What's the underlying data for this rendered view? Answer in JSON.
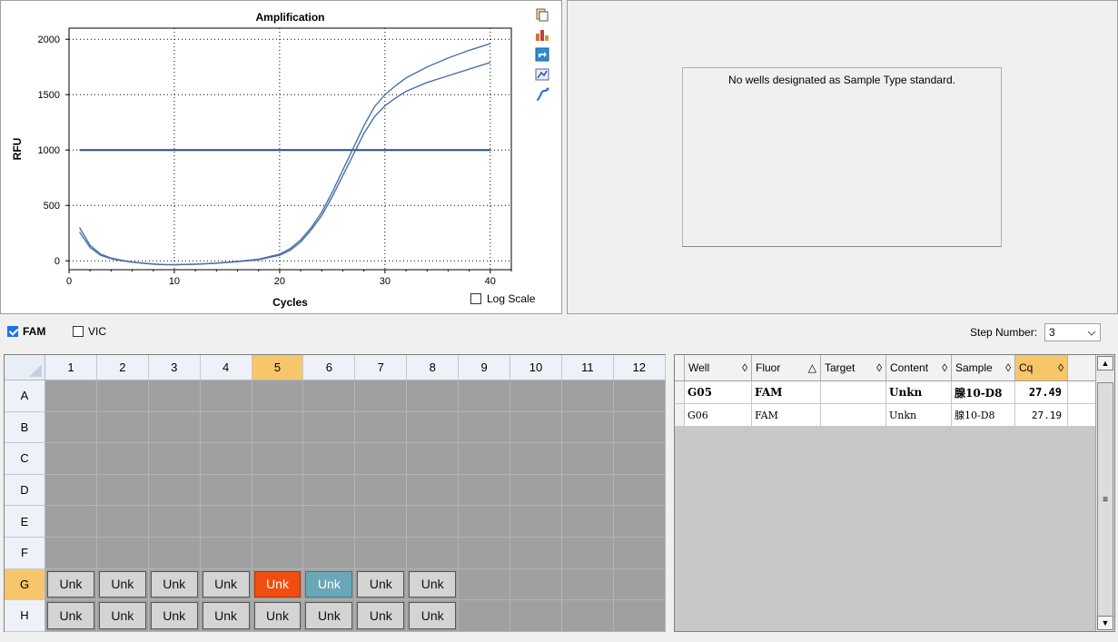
{
  "chart_data": {
    "type": "line",
    "title": "Amplification",
    "xlabel": "Cycles",
    "ylabel": "RFU",
    "xlim": [
      0,
      42
    ],
    "ylim": [
      -80,
      2100
    ],
    "x_ticks": [
      0,
      10,
      20,
      30,
      40
    ],
    "y_ticks": [
      0,
      500,
      1000,
      1500,
      2000
    ],
    "grid": true,
    "series": [
      {
        "color": "#4a72a8",
        "x": [
          1,
          2,
          3,
          4,
          5,
          6,
          7,
          8,
          9,
          10,
          12,
          14,
          16,
          18,
          20,
          21,
          22,
          23,
          24,
          25,
          26,
          27,
          28,
          29,
          30,
          31,
          32,
          34,
          36,
          38,
          40
        ],
        "y": [
          300,
          140,
          60,
          25,
          5,
          -10,
          -20,
          -28,
          -33,
          -35,
          -30,
          -20,
          -5,
          15,
          60,
          110,
          190,
          300,
          440,
          620,
          820,
          1020,
          1220,
          1390,
          1500,
          1580,
          1650,
          1750,
          1830,
          1900,
          1960
        ]
      },
      {
        "color": "#4a72a8",
        "x": [
          1,
          2,
          3,
          4,
          5,
          6,
          7,
          8,
          9,
          10,
          12,
          14,
          16,
          18,
          20,
          21,
          22,
          23,
          24,
          25,
          26,
          27,
          28,
          29,
          30,
          31,
          32,
          34,
          36,
          38,
          40
        ],
        "y": [
          260,
          120,
          50,
          18,
          0,
          -12,
          -22,
          -30,
          -34,
          -36,
          -31,
          -22,
          -8,
          10,
          50,
          95,
          170,
          280,
          410,
          580,
          770,
          960,
          1150,
          1300,
          1400,
          1470,
          1530,
          1610,
          1670,
          1730,
          1790
        ]
      }
    ],
    "threshold": {
      "value": 1000,
      "x_start": 1,
      "x_end": 40,
      "color": "#1f4e8c"
    }
  },
  "chart": {
    "log_scale_label": "Log Scale"
  },
  "toolbar": {
    "icons": [
      "copy-icon",
      "export-icon",
      "refresh-icon",
      "chart-settings-icon",
      "curve-icon"
    ]
  },
  "standard": {
    "message": "No wells designated as Sample Type standard."
  },
  "fluors": {
    "fam": "FAM",
    "vic": "VIC",
    "fam_checked": true,
    "vic_checked": false
  },
  "step": {
    "label": "Step Number:",
    "value": "3"
  },
  "plate": {
    "columns": [
      "1",
      "2",
      "3",
      "4",
      "5",
      "6",
      "7",
      "8",
      "9",
      "10",
      "11",
      "12"
    ],
    "rows": [
      "A",
      "B",
      "C",
      "D",
      "E",
      "F",
      "G",
      "H"
    ],
    "selected_column": "5",
    "selected_row": "G",
    "wells": {
      "G": [
        "Unk",
        "Unk",
        "Unk",
        "Unk",
        "Unk",
        "Unk",
        "Unk",
        "Unk"
      ],
      "H": [
        "Unk",
        "Unk",
        "Unk",
        "Unk",
        "Unk",
        "Unk",
        "Unk",
        "Unk"
      ]
    },
    "highlight": {
      "orange": "G5",
      "teal": "G6"
    }
  },
  "table": {
    "headers": [
      {
        "label": "Well",
        "sort": "◊"
      },
      {
        "label": "Fluor",
        "sort": "△"
      },
      {
        "label": "Target",
        "sort": "◊"
      },
      {
        "label": "Content",
        "sort": "◊"
      },
      {
        "label": "Sample",
        "sort": "◊"
      },
      {
        "label": "Cq",
        "sort": "◊"
      }
    ],
    "rows": [
      {
        "well": "G05",
        "fluor": "FAM",
        "target": "",
        "content": "Unkn",
        "sample": "腺10-D8",
        "cq": "27.49",
        "bold": true
      },
      {
        "well": "G06",
        "fluor": "FAM",
        "target": "",
        "content": "Unkn",
        "sample": "腺10-D8",
        "cq": "27.19",
        "bold": false
      }
    ]
  }
}
